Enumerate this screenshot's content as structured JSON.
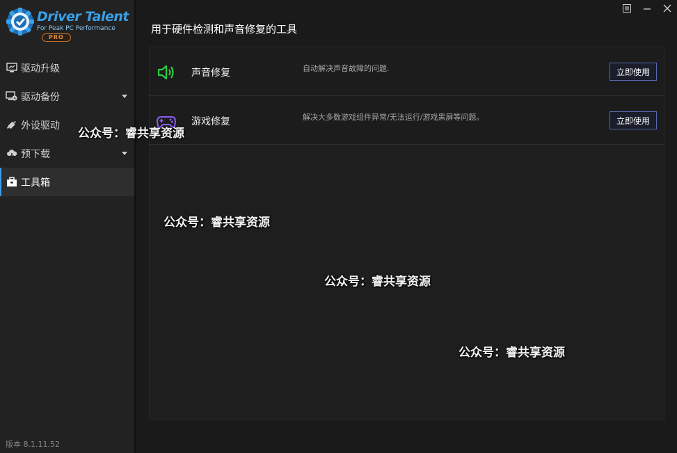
{
  "app": {
    "logo_title": "Driver Talent",
    "logo_sub": "For Peak PC Performance",
    "logo_badge": "PRO",
    "version": "版本 8.1.11.52",
    "accent": "#3aa0e8"
  },
  "sidebar": {
    "items": [
      {
        "label": "驱动升级",
        "icon": "monitor-icon",
        "has_arrow": false,
        "active": false
      },
      {
        "label": "驱动备份",
        "icon": "backup-icon",
        "has_arrow": true,
        "active": false
      },
      {
        "label": "外设驱动",
        "icon": "plug-icon",
        "has_arrow": false,
        "active": false
      },
      {
        "label": "预下载",
        "icon": "cloud-download-icon",
        "has_arrow": true,
        "active": false
      },
      {
        "label": "工具箱",
        "icon": "toolbox-icon",
        "has_arrow": false,
        "active": true
      }
    ]
  },
  "titlebar": {
    "icons": [
      "menu-icon",
      "minimize-icon",
      "close-icon"
    ]
  },
  "main": {
    "title": "用于硬件检测和声音修复的工具",
    "tools": [
      {
        "name": "声音修复",
        "desc": "自动解决声音故障的问题.",
        "button": "立即使用",
        "icon": "speaker-icon",
        "icon_color": "#2ecc40"
      },
      {
        "name": "游戏修复",
        "desc": "解决大多数游戏组件异常/无法运行/游戏黑屏等问题。",
        "button": "立即使用",
        "icon": "gamepad-icon",
        "icon_color": "#8a5cf0"
      }
    ]
  },
  "watermarks": [
    "公众号：睿共享资源",
    "公众号：睿共享资源",
    "公众号：睿共享资源",
    "公众号：睿共享资源"
  ]
}
